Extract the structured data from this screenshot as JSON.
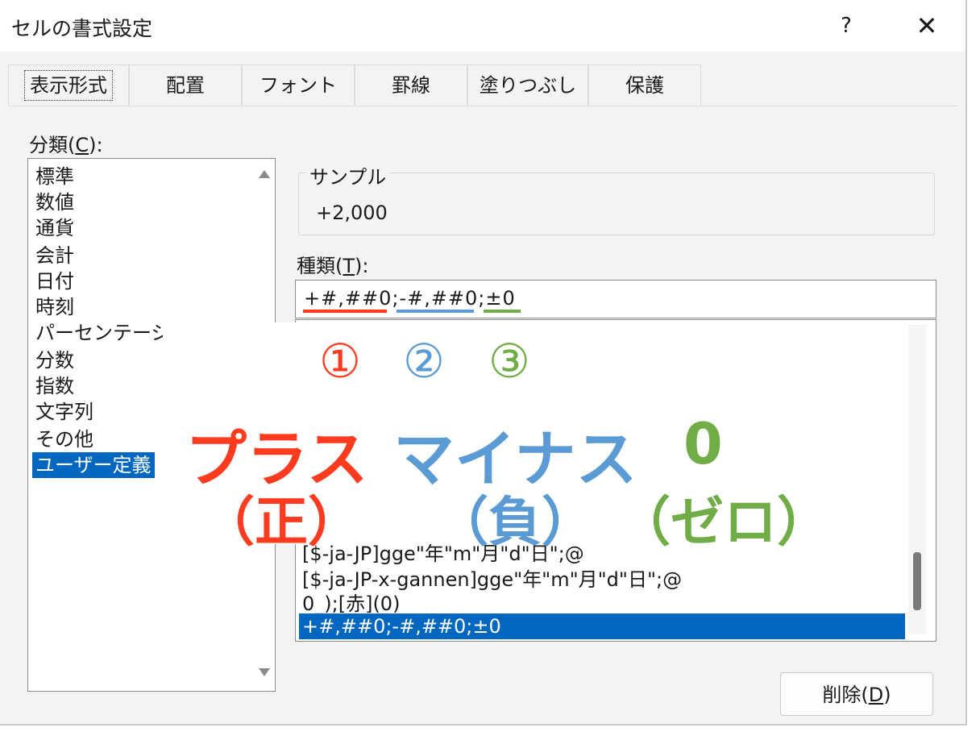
{
  "window": {
    "title": "セルの書式設定",
    "help": "?",
    "close": "✕"
  },
  "tabs": [
    {
      "label": "表示形式",
      "active": true
    },
    {
      "label": "配置"
    },
    {
      "label": "フォント"
    },
    {
      "label": "罫線"
    },
    {
      "label": "塗りつぶし"
    },
    {
      "label": "保護"
    }
  ],
  "category": {
    "label_prefix": "分類(",
    "label_key": "C",
    "label_suffix": "):",
    "items": [
      "標準",
      "数値",
      "通貨",
      "会計",
      "日付",
      "時刻",
      "パーセンテージ",
      "分数",
      "指数",
      "文字列",
      "その他",
      "ユーザー定義"
    ],
    "selected_index": 11
  },
  "sample": {
    "label": "サンプル",
    "value": "+2,000"
  },
  "type": {
    "label_prefix": "種類(",
    "label_key": "T",
    "label_suffix": "):",
    "value": "+#,##0;-#,##0;±0",
    "list": [
      "[$-ja-JP]gge\"年\"m\"月\"d\"日\";@",
      "[$-ja-JP-x-gannen]gge\"年\"m\"月\"d\"日\";@",
      "0_);[赤](0)",
      "+#,##0;-#,##0;±0"
    ]
  },
  "delete_button": {
    "label_prefix": "削除(",
    "label_key": "D",
    "label_suffix": ")"
  },
  "annotations": {
    "n1": "①",
    "n2": "②",
    "n3": "③",
    "plus": "プラス",
    "plus_sub": "（正）",
    "minus": "マイナス",
    "minus_sub": "（負）",
    "zero": "0",
    "zero_sub": "（ゼロ）",
    "colors": {
      "positive": "#ff3b1f",
      "negative": "#5b9bd5",
      "zero": "#70ad47"
    }
  },
  "colors": {
    "selection": "#0067c0",
    "dialog_bg": "#f3f3f3"
  }
}
